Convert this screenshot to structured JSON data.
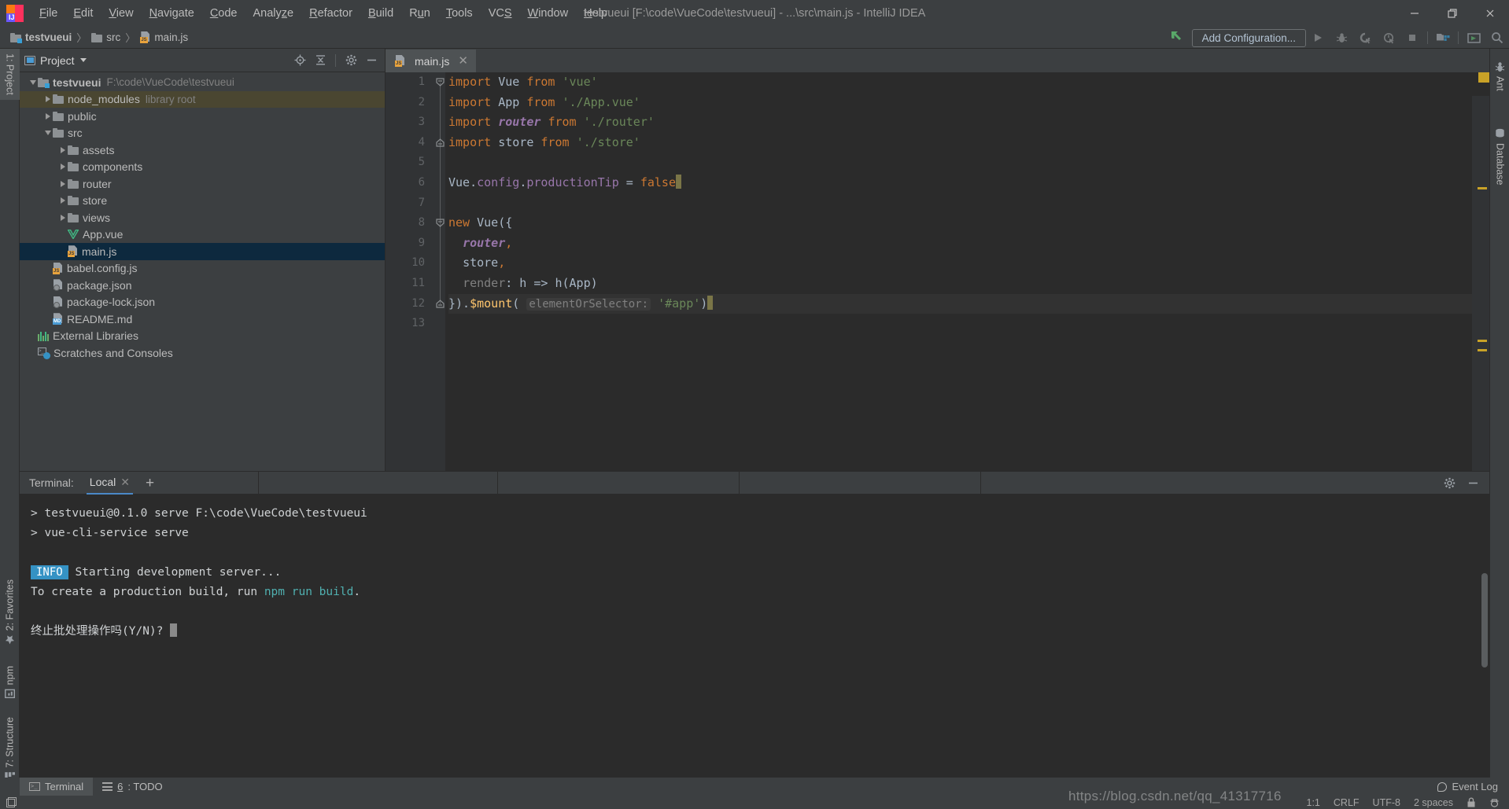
{
  "window": {
    "title": "testvueui [F:\\code\\VueCode\\testvueui] - ...\\src\\main.js - IntelliJ IDEA",
    "minimize": "–",
    "maximize": "□",
    "close": "✕"
  },
  "menu": {
    "items": [
      {
        "label": "File",
        "mnemonic": "F"
      },
      {
        "label": "Edit",
        "mnemonic": "E"
      },
      {
        "label": "View",
        "mnemonic": "V"
      },
      {
        "label": "Navigate",
        "mnemonic": "N"
      },
      {
        "label": "Code",
        "mnemonic": "C"
      },
      {
        "label": "Analyze",
        "mnemonic": "z"
      },
      {
        "label": "Refactor",
        "mnemonic": "R"
      },
      {
        "label": "Build",
        "mnemonic": "B"
      },
      {
        "label": "Run",
        "mnemonic": "u"
      },
      {
        "label": "Tools",
        "mnemonic": "T"
      },
      {
        "label": "VCS",
        "mnemonic": "S"
      },
      {
        "label": "Window",
        "mnemonic": "W"
      },
      {
        "label": "Help",
        "mnemonic": "H"
      }
    ]
  },
  "breadcrumb": {
    "items": [
      "testvueui",
      "src",
      "main.js"
    ],
    "separator": "〉"
  },
  "toolbar": {
    "add_configuration": "Add Configuration...",
    "run": "run-icon",
    "debug": "debug-icon",
    "coverage": "run-with-coverage-icon",
    "profile": "profiler-icon",
    "stop": "stop-icon",
    "project_structure": "project-structure-icon",
    "update": "update-icon",
    "search": "search-everywhere-icon"
  },
  "left_strip": {
    "items": [
      {
        "label": "1: Project",
        "active": true
      },
      {
        "label": "2: Favorites",
        "active": false
      },
      {
        "label": "npm",
        "active": false
      },
      {
        "label": "7: Structure",
        "active": false
      }
    ]
  },
  "right_strip": {
    "items": [
      {
        "label": "Ant",
        "icon": "ant-icon"
      },
      {
        "label": "Database",
        "icon": "database-icon"
      }
    ]
  },
  "project_panel": {
    "title": "Project",
    "icons": [
      "locate-icon",
      "collapse-all-icon",
      "settings-gear-icon",
      "hide-icon"
    ],
    "tree": [
      {
        "depth": 0,
        "arrow": "down",
        "icon": "module-folder",
        "name": "testvueui",
        "secondary": "F:\\code\\VueCode\\testvueui",
        "bold": true,
        "state": "none"
      },
      {
        "depth": 1,
        "arrow": "right",
        "icon": "folder",
        "name": "node_modules",
        "secondary": "library root",
        "bold": false,
        "state": "highlight"
      },
      {
        "depth": 1,
        "arrow": "right",
        "icon": "folder",
        "name": "public",
        "secondary": "",
        "bold": false,
        "state": "none"
      },
      {
        "depth": 1,
        "arrow": "down",
        "icon": "folder",
        "name": "src",
        "secondary": "",
        "bold": false,
        "state": "none"
      },
      {
        "depth": 2,
        "arrow": "right",
        "icon": "folder",
        "name": "assets",
        "secondary": "",
        "bold": false,
        "state": "none"
      },
      {
        "depth": 2,
        "arrow": "right",
        "icon": "folder",
        "name": "components",
        "secondary": "",
        "bold": false,
        "state": "none"
      },
      {
        "depth": 2,
        "arrow": "right",
        "icon": "folder",
        "name": "router",
        "secondary": "",
        "bold": false,
        "state": "none"
      },
      {
        "depth": 2,
        "arrow": "right",
        "icon": "folder",
        "name": "store",
        "secondary": "",
        "bold": false,
        "state": "none"
      },
      {
        "depth": 2,
        "arrow": "right",
        "icon": "folder",
        "name": "views",
        "secondary": "",
        "bold": false,
        "state": "none"
      },
      {
        "depth": 2,
        "arrow": "none",
        "icon": "vue-file",
        "name": "App.vue",
        "secondary": "",
        "bold": false,
        "state": "none"
      },
      {
        "depth": 2,
        "arrow": "none",
        "icon": "js-file",
        "name": "main.js",
        "secondary": "",
        "bold": false,
        "state": "selected"
      },
      {
        "depth": 1,
        "arrow": "none",
        "icon": "js-file",
        "name": "babel.config.js",
        "secondary": "",
        "bold": false,
        "state": "none"
      },
      {
        "depth": 1,
        "arrow": "none",
        "icon": "json-file",
        "name": "package.json",
        "secondary": "",
        "bold": false,
        "state": "none"
      },
      {
        "depth": 1,
        "arrow": "none",
        "icon": "json-file",
        "name": "package-lock.json",
        "secondary": "",
        "bold": false,
        "state": "none"
      },
      {
        "depth": 1,
        "arrow": "none",
        "icon": "md-file",
        "name": "README.md",
        "secondary": "",
        "bold": false,
        "state": "none"
      },
      {
        "depth": 0,
        "arrow": "none",
        "icon": "libraries",
        "name": "External Libraries",
        "secondary": "",
        "bold": false,
        "state": "none"
      },
      {
        "depth": 0,
        "arrow": "none",
        "icon": "scratches",
        "name": "Scratches and Consoles",
        "secondary": "",
        "bold": false,
        "state": "none"
      }
    ]
  },
  "editor": {
    "tabs": [
      {
        "label": "main.js",
        "icon": "js-file",
        "active": true,
        "close": "✕"
      }
    ],
    "line_numbers": [
      "1",
      "2",
      "3",
      "4",
      "5",
      "6",
      "7",
      "8",
      "9",
      "10",
      "11",
      "12",
      "13"
    ],
    "lines": [
      [
        {
          "t": "import",
          "c": "kw"
        },
        {
          "t": " ",
          "c": "def"
        },
        {
          "t": "Vue",
          "c": "def"
        },
        {
          "t": " ",
          "c": "def"
        },
        {
          "t": "from",
          "c": "kw"
        },
        {
          "t": " ",
          "c": "def"
        },
        {
          "t": "'vue'",
          "c": "str"
        }
      ],
      [
        {
          "t": "import",
          "c": "kw"
        },
        {
          "t": " ",
          "c": "def"
        },
        {
          "t": "App",
          "c": "def"
        },
        {
          "t": " ",
          "c": "def"
        },
        {
          "t": "from",
          "c": "kw"
        },
        {
          "t": " ",
          "c": "def"
        },
        {
          "t": "'./App.vue'",
          "c": "str"
        }
      ],
      [
        {
          "t": "import",
          "c": "kw"
        },
        {
          "t": " ",
          "c": "def"
        },
        {
          "t": "router",
          "c": "ital"
        },
        {
          "t": " ",
          "c": "def"
        },
        {
          "t": "from",
          "c": "kw"
        },
        {
          "t": " ",
          "c": "def"
        },
        {
          "t": "'./router'",
          "c": "str"
        }
      ],
      [
        {
          "t": "import",
          "c": "kw"
        },
        {
          "t": " ",
          "c": "def"
        },
        {
          "t": "store",
          "c": "def"
        },
        {
          "t": " ",
          "c": "def"
        },
        {
          "t": "from",
          "c": "kw"
        },
        {
          "t": " ",
          "c": "def"
        },
        {
          "t": "'./store'",
          "c": "str"
        }
      ],
      [],
      [
        {
          "t": "Vue",
          "c": "def"
        },
        {
          "t": ".",
          "c": "def"
        },
        {
          "t": "config",
          "c": "prop"
        },
        {
          "t": ".",
          "c": "def"
        },
        {
          "t": "productionTip",
          "c": "prop"
        },
        {
          "t": " = ",
          "c": "def"
        },
        {
          "t": "false",
          "c": "kw"
        },
        {
          "t": "|CARET|",
          "c": "caret"
        }
      ],
      [],
      [
        {
          "t": "new",
          "c": "kw"
        },
        {
          "t": " ",
          "c": "def"
        },
        {
          "t": "Vue",
          "c": "def"
        },
        {
          "t": "({",
          "c": "def"
        }
      ],
      [
        {
          "t": "  ",
          "c": "def"
        },
        {
          "t": "router",
          "c": "ital"
        },
        {
          "t": ",",
          "c": "kw"
        }
      ],
      [
        {
          "t": "  ",
          "c": "def"
        },
        {
          "t": "store",
          "c": "def"
        },
        {
          "t": ",",
          "c": "kw"
        }
      ],
      [
        {
          "t": "  ",
          "c": "def"
        },
        {
          "t": "render",
          "c": "gray"
        },
        {
          "t": ": h => h(App)",
          "c": "def"
        }
      ],
      [
        {
          "t": "}).",
          "c": "def"
        },
        {
          "t": "$mount",
          "c": "fn"
        },
        {
          "t": "( ",
          "c": "def"
        },
        {
          "t": "elementOrSelector:",
          "c": "hint"
        },
        {
          "t": " ",
          "c": "def"
        },
        {
          "t": "'#app'",
          "c": "str"
        },
        {
          "t": ")",
          "c": "def"
        },
        {
          "t": "|CARET|",
          "c": "caret"
        }
      ],
      []
    ],
    "current_line": 12,
    "fold_rows": [
      0,
      3,
      7,
      11
    ],
    "warning_marks": [
      0,
      6,
      11,
      12
    ]
  },
  "terminal": {
    "label": "Terminal:",
    "tab": "Local",
    "tab_close": "✕",
    "add": "+",
    "settings_icon": "gear-icon",
    "hide_icon": "hide-icon",
    "lines": [
      {
        "type": "cmd",
        "text": "> testvueui@0.1.0 serve F:\\code\\VueCode\\testvueui"
      },
      {
        "type": "cmd",
        "text": "> vue-cli-service serve"
      },
      {
        "type": "blank",
        "text": ""
      },
      {
        "type": "info",
        "badge": "INFO",
        "text": "Starting development server..."
      },
      {
        "type": "build",
        "pre": "  To create a production build, run ",
        "cmd": "npm run build",
        "post": "."
      },
      {
        "type": "blank",
        "text": ""
      },
      {
        "type": "prompt",
        "text": "终止批处理操作吗(Y/N)? "
      }
    ]
  },
  "bottom_bar": {
    "tabs": [
      {
        "label": "Terminal",
        "icon": "terminal-icon",
        "active": true,
        "prefix": ""
      },
      {
        "label": ": TODO",
        "icon": "todo-list-icon",
        "active": false,
        "prefix": "6"
      }
    ]
  },
  "status_bar": {
    "caret_position": "1:1",
    "line_separator": "CRLF",
    "encoding": "UTF-8",
    "indent": "2 spaces",
    "event_log": "Event Log"
  },
  "watermark": {
    "text": "https://blog.csdn.net/qq_41317716"
  },
  "colors": {
    "accent_blue": "#3592c4",
    "selection": "#0d293e",
    "highlight": "#4a4631",
    "warning": "#c9a227",
    "keyword": "#cc7832",
    "string": "#6a8759",
    "default_text": "#a9b7c6"
  }
}
